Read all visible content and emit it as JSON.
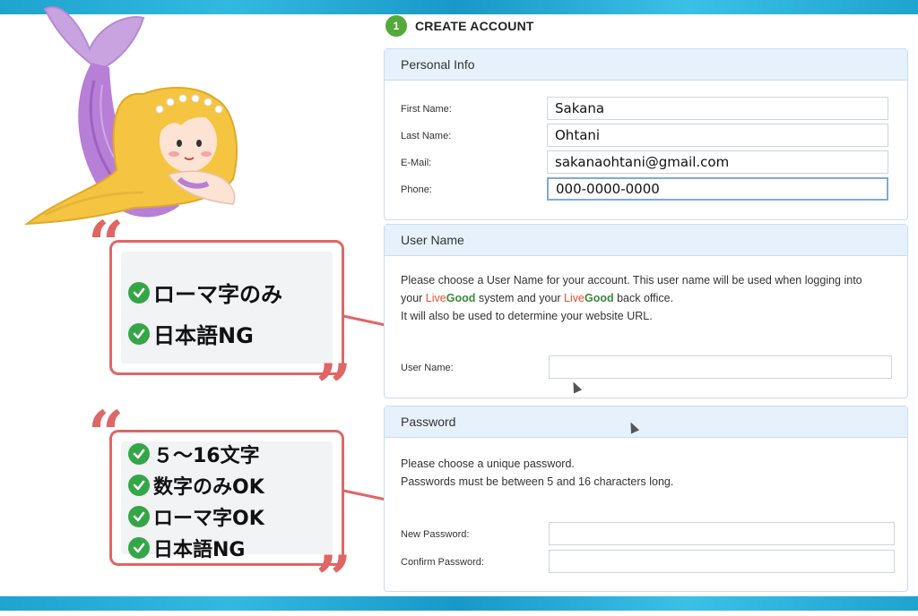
{
  "step": {
    "number": "1",
    "title": "CREATE ACCOUNT"
  },
  "personal_info": {
    "heading": "Personal Info",
    "fields": [
      {
        "label": "First Name:",
        "value": "Sakana"
      },
      {
        "label": "Last Name:",
        "value": "Ohtani"
      },
      {
        "label": "E-Mail:",
        "value": "sakanaohtani@gmail.com"
      },
      {
        "label": "Phone:",
        "value": "000-0000-0000"
      }
    ]
  },
  "user_name": {
    "heading": "User Name",
    "desc_line1": "Please choose a User Name for your account. This user name will be used when logging into",
    "desc_line2_a": "your ",
    "desc_line2_b": " system and your ",
    "desc_line2_c": " back office.",
    "desc_line3": "It will also be used to determine your website URL.",
    "brand_live": "Live",
    "brand_good": "Good",
    "label": "User Name:",
    "value": ""
  },
  "password": {
    "heading": "Password",
    "desc_line1": "Please choose a unique password.",
    "desc_line2": "Passwords must be between 5 and 16 characters long.",
    "new_label": "New Password:",
    "confirm_label": "Confirm Password:",
    "new_value": "",
    "confirm_value": ""
  },
  "callout_username": {
    "items": [
      "ローマ字のみ",
      "日本語NG"
    ]
  },
  "callout_password": {
    "items": [
      "５～16文字",
      "数字のみOK",
      "ローマ字OK",
      "日本語NG"
    ]
  },
  "quote_open": "“",
  "quote_close": "”",
  "colors": {
    "callout_border": "#e06666",
    "check_green": "#35a648",
    "step_green": "#55a93b",
    "panel_header": "#e6f1fc",
    "brand_live": "#e8542b",
    "brand_good": "#3a8a3a"
  }
}
